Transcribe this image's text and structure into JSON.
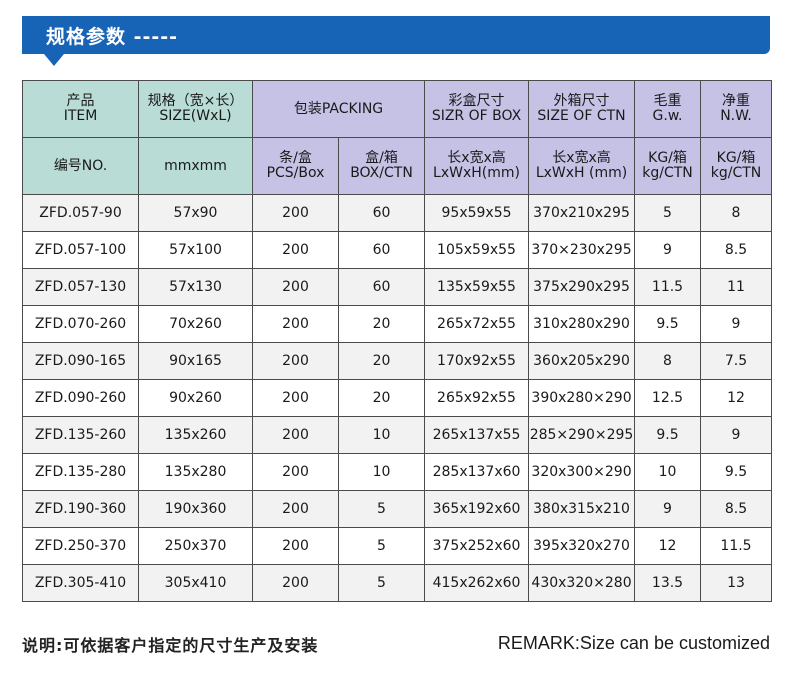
{
  "title": "规格参数 -----",
  "header": {
    "row1": [
      {
        "key": "item",
        "lines": [
          "产品",
          "ITEM"
        ],
        "color": "#b9dcd6"
      },
      {
        "key": "size",
        "lines": [
          "规格（宽×长）",
          "SIZE(WxL)"
        ],
        "color": "#b9dcd6"
      },
      {
        "key": "packing",
        "lines": [
          "包装PACKING"
        ],
        "color": "#c5c2e6"
      },
      {
        "key": "box",
        "lines": [
          "彩盒尺寸",
          "SIZR OF BOX"
        ],
        "color": "#c5c2e6"
      },
      {
        "key": "ctn",
        "lines": [
          "外箱尺寸",
          "SIZE OF CTN"
        ],
        "color": "#c5c2e6"
      },
      {
        "key": "gw",
        "lines": [
          "毛重",
          "G.w."
        ],
        "color": "#c5c2e6"
      },
      {
        "key": "nw",
        "lines": [
          "净重",
          "N.W."
        ],
        "color": "#c5c2e6"
      }
    ],
    "row2": [
      {
        "key": "code",
        "lines": [
          "编号NO."
        ],
        "color": "#b9dcd6"
      },
      {
        "key": "unit",
        "lines": [
          "mmxmm"
        ],
        "color": "#b9dcd6"
      },
      {
        "key": "pcs",
        "lines": [
          "条/盒",
          "PCS/Box"
        ],
        "color": "#c5c2e6"
      },
      {
        "key": "boxctn",
        "lines": [
          "盒/箱",
          "BOX/CTN"
        ],
        "color": "#c5c2e6"
      },
      {
        "key": "boxdim",
        "lines": [
          "长x宽x高",
          "LxWxH(mm)"
        ],
        "color": "#c5c2e6"
      },
      {
        "key": "ctndim",
        "lines": [
          "长x宽x高",
          "LxWxH (mm)"
        ],
        "color": "#c5c2e6"
      },
      {
        "key": "gwunit",
        "lines": [
          "KG/箱",
          "kg/CTN"
        ],
        "color": "#c5c2e6"
      },
      {
        "key": "nwunit",
        "lines": [
          "KG/箱",
          "kg/CTN"
        ],
        "color": "#c5c2e6"
      }
    ]
  },
  "rows": [
    [
      "ZFD.057-90",
      "57x90",
      "200",
      "60",
      "95x59x55",
      "370x210x295",
      "5",
      "8"
    ],
    [
      "ZFD.057-100",
      "57x100",
      "200",
      "60",
      "105x59x55",
      "370×230x295",
      "9",
      "8.5"
    ],
    [
      "ZFD.057-130",
      "57x130",
      "200",
      "60",
      "135x59x55",
      "375x290x295",
      "11.5",
      "11"
    ],
    [
      "ZFD.070-260",
      "70x260",
      "200",
      "20",
      "265x72x55",
      "310x280x290",
      "9.5",
      "9"
    ],
    [
      "ZFD.090-165",
      "90x165",
      "200",
      "20",
      "170x92x55",
      "360x205x290",
      "8",
      "7.5"
    ],
    [
      "ZFD.090-260",
      "90x260",
      "200",
      "20",
      "265x92x55",
      "390x280×290",
      "12.5",
      "12"
    ],
    [
      "ZFD.135-260",
      "135x260",
      "200",
      "10",
      "265x137x55",
      "285×290×295",
      "9.5",
      "9"
    ],
    [
      "ZFD.135-280",
      "135x280",
      "200",
      "10",
      "285x137x60",
      "320x300×290",
      "10",
      "9.5"
    ],
    [
      "ZFD.190-360",
      "190x360",
      "200",
      "5",
      "365x192x60",
      "380x315x210",
      "9",
      "8.5"
    ],
    [
      "ZFD.250-370",
      "250x370",
      "200",
      "5",
      "375x252x60",
      "395x320x270",
      "12",
      "11.5"
    ],
    [
      "ZFD.305-410",
      "305x410",
      "200",
      "5",
      "415x262x60",
      "430x320×280",
      "13.5",
      "13"
    ]
  ],
  "footer": {
    "note_cn": "说明:可依据客户指定的尺寸生产及安装",
    "remark": "REMARK:Size can be customized"
  },
  "colors": {
    "header_bar": "#1763b5",
    "green": "#b9dcd6",
    "purple": "#c5c2e6"
  }
}
